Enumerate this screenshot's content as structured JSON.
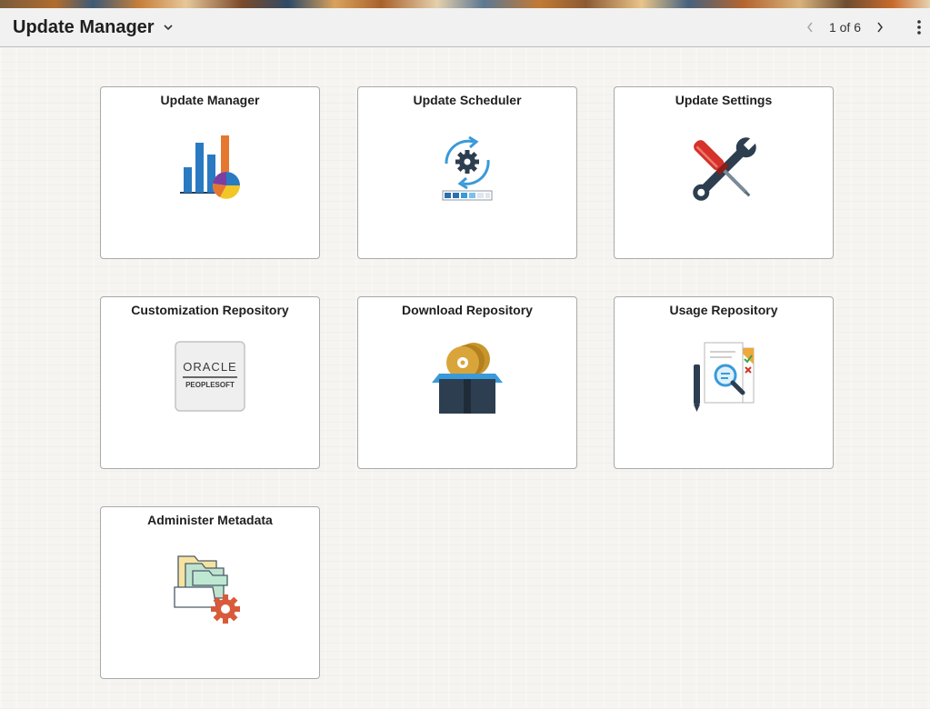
{
  "header": {
    "title": "Update Manager",
    "pager_text": "1 of 6"
  },
  "tiles": [
    {
      "title": "Update Manager",
      "icon": "analytics-chart-icon"
    },
    {
      "title": "Update Scheduler",
      "icon": "scheduler-gear-icon"
    },
    {
      "title": "Update Settings",
      "icon": "wrench-screwdriver-icon"
    },
    {
      "title": "Customization Repository",
      "icon": "oracle-peoplesoft-logo",
      "logo_top": "ORACLE",
      "logo_bottom": "PEOPLESOFT"
    },
    {
      "title": "Download Repository",
      "icon": "open-box-disc-icon"
    },
    {
      "title": "Usage Repository",
      "icon": "document-search-icon"
    },
    {
      "title": "Administer Metadata",
      "icon": "folders-gear-icon"
    }
  ],
  "colors": {
    "header_bg": "#f1f1f1",
    "tile_border": "#a9a9a9",
    "accent_blue": "#2a7ac2",
    "accent_orange": "#e6772e",
    "accent_red": "#d4322a"
  }
}
